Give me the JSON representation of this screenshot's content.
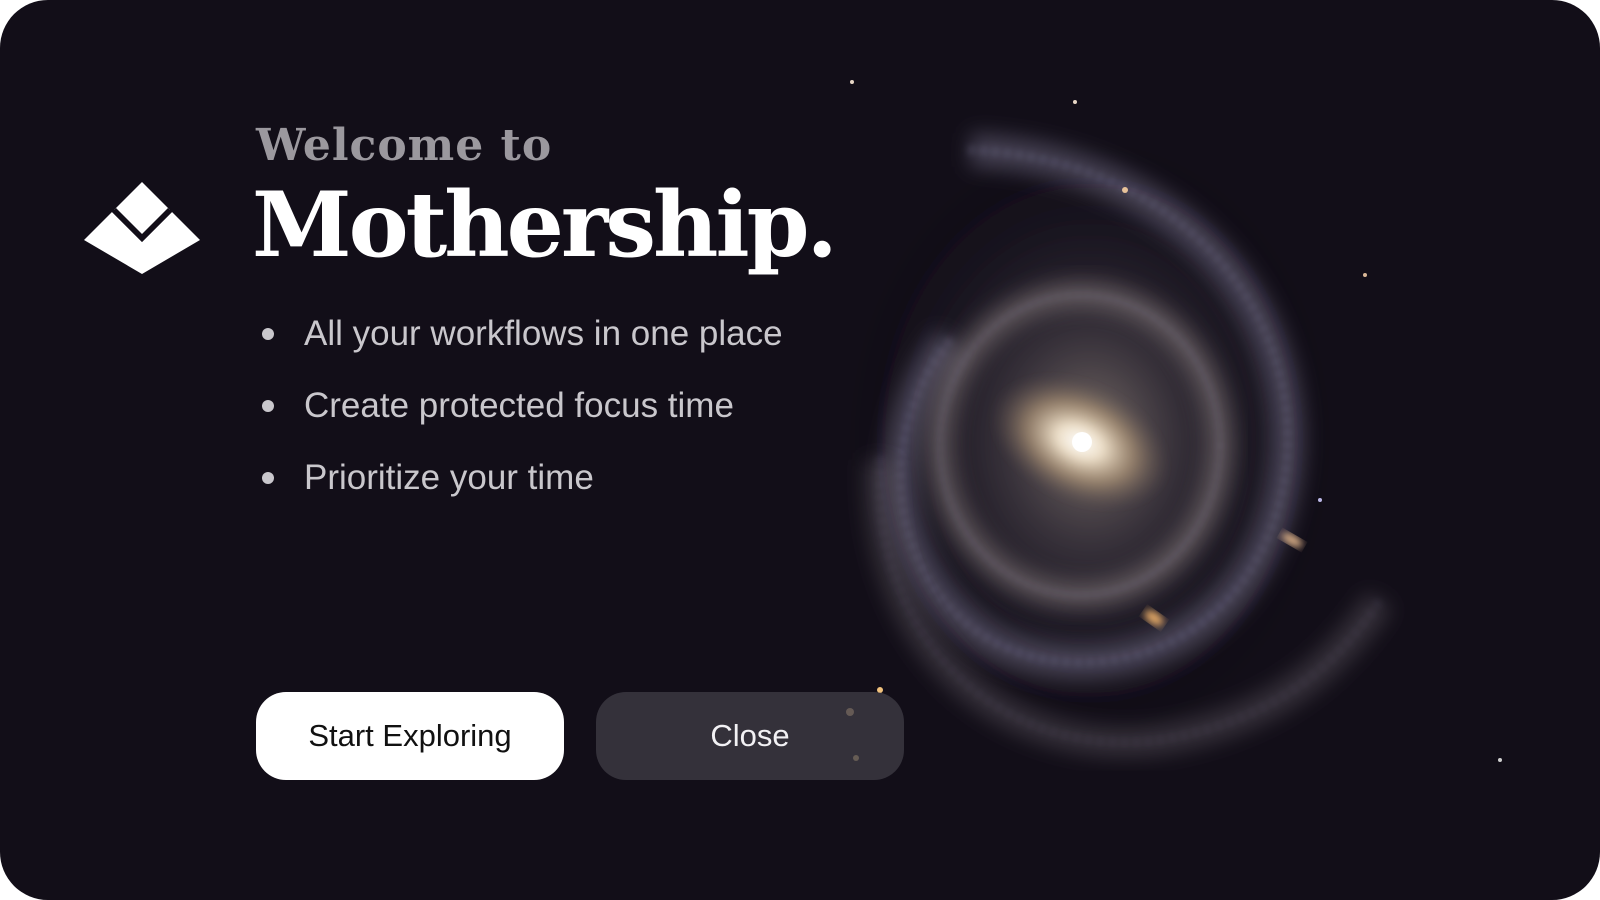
{
  "dialog": {
    "welcome_text": "Welcome to",
    "app_name": "Mothership.",
    "features": [
      "All your workflows in one place",
      "Create protected focus time",
      "Prioritize your time"
    ],
    "buttons": {
      "primary_label": "Start Exploring",
      "secondary_label": "Close"
    }
  },
  "icons": {
    "logo": "mothership-logo-icon",
    "bullet": "bullet-dot-icon",
    "background_image": "spiral-galaxy-image"
  },
  "colors": {
    "background": "#120e18",
    "brand_text": "#ffffff",
    "welcome_text": "#9b989e",
    "feature_text": "#c9c7cc",
    "primary_button_bg": "#ffffff",
    "secondary_button_bg": "#3e3b44"
  }
}
